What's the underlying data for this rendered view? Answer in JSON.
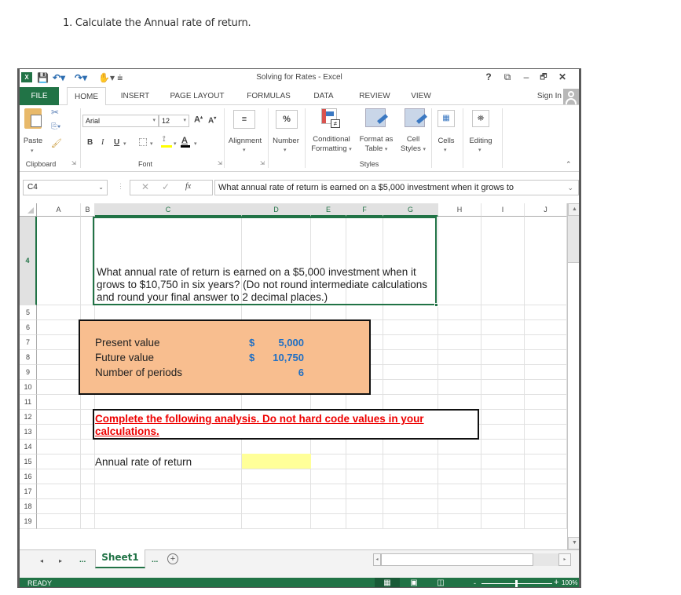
{
  "question": {
    "title": "1. Calculate the Annual rate of return."
  },
  "window": {
    "title": "Solving for Rates - Excel",
    "controls": {
      "help": "?",
      "ribbon_display": "⧉",
      "minimize": "–",
      "restore": "🗗",
      "close": "✕"
    },
    "sign_in": "Sign In"
  },
  "tabs": [
    "FILE",
    "HOME",
    "INSERT",
    "PAGE LAYOUT",
    "FORMULAS",
    "DATA",
    "REVIEW",
    "VIEW"
  ],
  "active_tab": "HOME",
  "ribbon": {
    "clipboard": {
      "paste": "Paste",
      "group_label": "Clipboard"
    },
    "font": {
      "font_name": "Arial",
      "font_size": "12",
      "bold": "B",
      "italic": "I",
      "underline": "U",
      "font_color_letter": "A",
      "group_label": "Font",
      "fill_color": "#ffff00",
      "font_color": "#000000"
    },
    "alignment": {
      "label": "Alignment"
    },
    "number": {
      "label": "Number",
      "icon_glyph": "%"
    },
    "styles": {
      "conditional": [
        "Conditional",
        "Formatting"
      ],
      "format_table": [
        "Format as",
        "Table"
      ],
      "cell_styles": [
        "Cell",
        "Styles"
      ],
      "group_label": "Styles"
    },
    "cells": {
      "label": "Cells"
    },
    "editing": {
      "label": "Editing"
    }
  },
  "formula_bar": {
    "name_box": "C4",
    "fx": "fx",
    "content": "What annual rate of return is earned on a $5,000 investment when it grows to"
  },
  "columns": [
    "A",
    "B",
    "C",
    "D",
    "E",
    "F",
    "G",
    "H",
    "I",
    "J"
  ],
  "selected_columns": [
    "C",
    "D",
    "E",
    "F",
    "G"
  ],
  "rows": [
    "4",
    "5",
    "6",
    "7",
    "8",
    "9",
    "10",
    "11",
    "12",
    "13",
    "14",
    "15",
    "16",
    "17",
    "18",
    "19"
  ],
  "selected_row": "4",
  "sheet": {
    "question_text": "What annual rate of return is earned on a $5,000 investment when it grows to $10,750 in six years? (Do not round intermediate calculations and round your final answer to 2 decimal places.)",
    "inputs": [
      {
        "label": "Present value",
        "currency": "$",
        "value": "5,000"
      },
      {
        "label": "Future value",
        "currency": "$",
        "value": "10,750"
      },
      {
        "label": "Number of periods",
        "currency": "",
        "value": "6"
      }
    ],
    "instruction": "Complete the following analysis. Do not hard code values in your calculations.",
    "output_label": "Annual rate of return",
    "output_value": "",
    "colors": {
      "input_box": "#f8be8f",
      "input_value": "#1f6fc4",
      "instruction": "#ee0000",
      "answer_cell": "#ffff99",
      "accent": "#217346"
    }
  },
  "sheet_tabs": {
    "prev": "◂",
    "next": "▸",
    "ellipsis_left": "...",
    "active": "Sheet1",
    "ellipsis_right": "...",
    "add": "+"
  },
  "status": {
    "text": "READY",
    "zoom": "100%",
    "zoom_minus": "-",
    "zoom_plus": "+"
  }
}
